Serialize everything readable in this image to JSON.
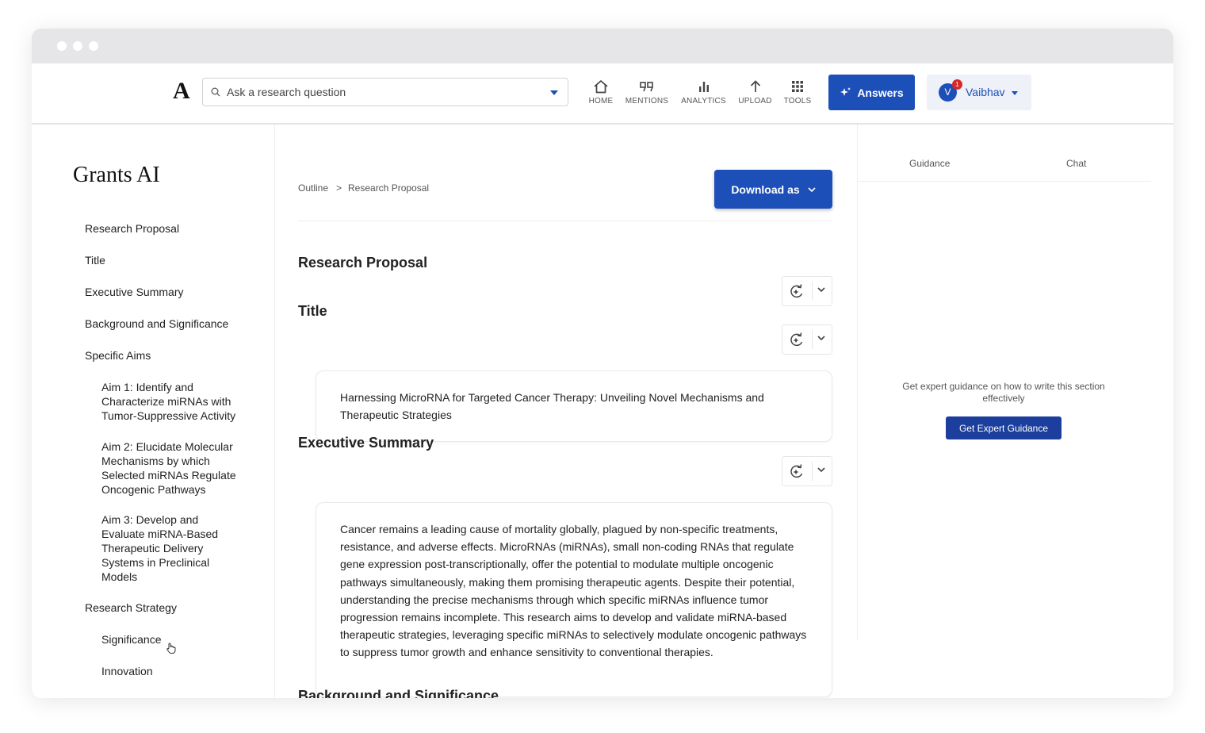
{
  "header": {
    "logo": "A",
    "search_placeholder": "Ask a research question",
    "nav": [
      {
        "label": "HOME",
        "icon": "home-icon"
      },
      {
        "label": "MENTIONS",
        "icon": "quote-icon"
      },
      {
        "label": "ANALYTICS",
        "icon": "bar-chart-icon"
      },
      {
        "label": "UPLOAD",
        "icon": "upload-arrow-icon"
      },
      {
        "label": "TOOLS",
        "icon": "grid-icon"
      }
    ],
    "answers_label": "Answers",
    "user": {
      "initial": "V",
      "name": "Vaibhav",
      "badge": "1"
    }
  },
  "sidebar": {
    "title": "Grants AI",
    "items": [
      {
        "label": "Research Proposal"
      },
      {
        "label": "Title"
      },
      {
        "label": "Executive Summary"
      },
      {
        "label": "Background and Significance"
      },
      {
        "label": "Specific Aims"
      },
      {
        "label": "Aim 1: Identify and Characterize miRNAs with Tumor-Suppressive Activity"
      },
      {
        "label": "Aim 2: Elucidate Molecular Mechanisms by which Selected miRNAs Regulate Oncogenic Pathways"
      },
      {
        "label": "Aim 3: Develop and Evaluate miRNA-Based Therapeutic Delivery Systems in Preclinical Models"
      },
      {
        "label": "Research Strategy"
      },
      {
        "label": "Significance"
      },
      {
        "label": "Innovation"
      }
    ]
  },
  "main": {
    "breadcrumb": {
      "root": "Outline",
      "separator": ">",
      "current": "Research Proposal"
    },
    "download_label": "Download as",
    "sections": [
      {
        "title": "Research Proposal"
      },
      {
        "title": "Title",
        "content": "Harnessing MicroRNA for Targeted Cancer Therapy: Unveiling Novel Mechanisms and Therapeutic Strategies"
      },
      {
        "title": "Executive Summary",
        "content": "Cancer remains a leading cause of mortality globally, plagued by non-specific treatments, resistance, and adverse effects. MicroRNAs (miRNAs), small non-coding RNAs that regulate gene expression post-transcriptionally, offer the potential to modulate multiple oncogenic pathways simultaneously, making them promising therapeutic agents. Despite their potential, understanding the precise mechanisms through which specific miRNAs influence tumor progression remains incomplete. This research aims to develop and validate miRNA-based therapeutic strategies, leveraging specific miRNAs to selectively modulate oncogenic pathways to suppress tumor growth and enhance sensitivity to conventional therapies."
      },
      {
        "title": "Background and Significance"
      }
    ]
  },
  "right_panel": {
    "tabs": [
      "Guidance",
      "Chat"
    ],
    "guidance_text": "Get expert guidance on how to write this section effectively",
    "guidance_button": "Get Expert Guidance"
  },
  "colors": {
    "primary": "#1c4fb8",
    "guidance_button": "#1c3f9e",
    "badge": "#d62a2a",
    "window_chrome": "#e6e6e9"
  }
}
